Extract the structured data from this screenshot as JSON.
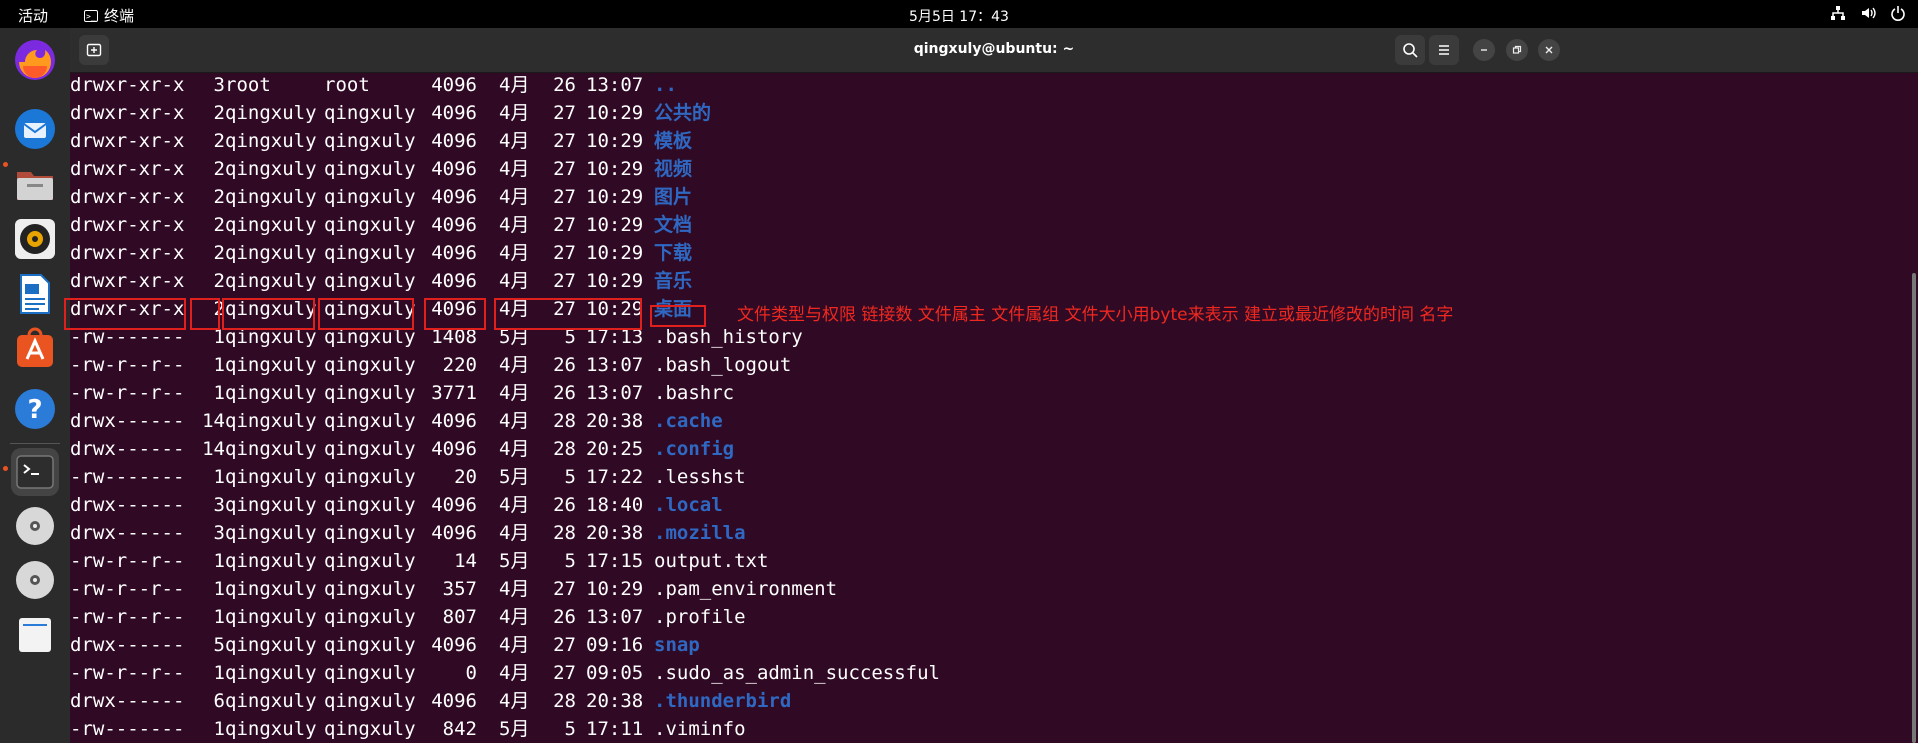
{
  "topbar": {
    "activities": "活动",
    "app_name": "终端",
    "clock": "5月5日  17：43"
  },
  "window": {
    "title": "qingxuly@ubuntu: ~"
  },
  "terminal": {
    "rows": [
      {
        "perm": "drwxr-xr-x",
        "links": "3",
        "owner": "root",
        "group": "root",
        "size": "4096",
        "month": "4月",
        "day": "26",
        "time": "13:07",
        "name": "..",
        "dir": true
      },
      {
        "perm": "drwxr-xr-x",
        "links": "2",
        "owner": "qingxuly",
        "group": "qingxuly",
        "size": "4096",
        "month": "4月",
        "day": "27",
        "time": "10:29",
        "name": "公共的",
        "dir": true
      },
      {
        "perm": "drwxr-xr-x",
        "links": "2",
        "owner": "qingxuly",
        "group": "qingxuly",
        "size": "4096",
        "month": "4月",
        "day": "27",
        "time": "10:29",
        "name": "模板",
        "dir": true
      },
      {
        "perm": "drwxr-xr-x",
        "links": "2",
        "owner": "qingxuly",
        "group": "qingxuly",
        "size": "4096",
        "month": "4月",
        "day": "27",
        "time": "10:29",
        "name": "视频",
        "dir": true
      },
      {
        "perm": "drwxr-xr-x",
        "links": "2",
        "owner": "qingxuly",
        "group": "qingxuly",
        "size": "4096",
        "month": "4月",
        "day": "27",
        "time": "10:29",
        "name": "图片",
        "dir": true
      },
      {
        "perm": "drwxr-xr-x",
        "links": "2",
        "owner": "qingxuly",
        "group": "qingxuly",
        "size": "4096",
        "month": "4月",
        "day": "27",
        "time": "10:29",
        "name": "文档",
        "dir": true
      },
      {
        "perm": "drwxr-xr-x",
        "links": "2",
        "owner": "qingxuly",
        "group": "qingxuly",
        "size": "4096",
        "month": "4月",
        "day": "27",
        "time": "10:29",
        "name": "下载",
        "dir": true
      },
      {
        "perm": "drwxr-xr-x",
        "links": "2",
        "owner": "qingxuly",
        "group": "qingxuly",
        "size": "4096",
        "month": "4月",
        "day": "27",
        "time": "10:29",
        "name": "音乐",
        "dir": true
      },
      {
        "perm": "drwxr-xr-x",
        "links": "2",
        "owner": "qingxuly",
        "group": "qingxuly",
        "size": "4096",
        "month": "4月",
        "day": "27",
        "time": "10:29",
        "name": "桌面",
        "dir": true
      },
      {
        "perm": "-rw-------",
        "links": "1",
        "owner": "qingxuly",
        "group": "qingxuly",
        "size": "1408",
        "month": "5月",
        "day": "5",
        "time": "17:13",
        "name": ".bash_history",
        "dir": false
      },
      {
        "perm": "-rw-r--r--",
        "links": "1",
        "owner": "qingxuly",
        "group": "qingxuly",
        "size": "220",
        "month": "4月",
        "day": "26",
        "time": "13:07",
        "name": ".bash_logout",
        "dir": false
      },
      {
        "perm": "-rw-r--r--",
        "links": "1",
        "owner": "qingxuly",
        "group": "qingxuly",
        "size": "3771",
        "month": "4月",
        "day": "26",
        "time": "13:07",
        "name": ".bashrc",
        "dir": false
      },
      {
        "perm": "drwx------",
        "links": "14",
        "owner": "qingxuly",
        "group": "qingxuly",
        "size": "4096",
        "month": "4月",
        "day": "28",
        "time": "20:38",
        "name": ".cache",
        "dir": true
      },
      {
        "perm": "drwx------",
        "links": "14",
        "owner": "qingxuly",
        "group": "qingxuly",
        "size": "4096",
        "month": "4月",
        "day": "28",
        "time": "20:25",
        "name": ".config",
        "dir": true
      },
      {
        "perm": "-rw-------",
        "links": "1",
        "owner": "qingxuly",
        "group": "qingxuly",
        "size": "20",
        "month": "5月",
        "day": "5",
        "time": "17:22",
        "name": ".lesshst",
        "dir": false
      },
      {
        "perm": "drwx------",
        "links": "3",
        "owner": "qingxuly",
        "group": "qingxuly",
        "size": "4096",
        "month": "4月",
        "day": "26",
        "time": "18:40",
        "name": ".local",
        "dir": true
      },
      {
        "perm": "drwx------",
        "links": "3",
        "owner": "qingxuly",
        "group": "qingxuly",
        "size": "4096",
        "month": "4月",
        "day": "28",
        "time": "20:38",
        "name": ".mozilla",
        "dir": true
      },
      {
        "perm": "-rw-r--r--",
        "links": "1",
        "owner": "qingxuly",
        "group": "qingxuly",
        "size": "14",
        "month": "5月",
        "day": "5",
        "time": "17:15",
        "name": "output.txt",
        "dir": false
      },
      {
        "perm": "-rw-r--r--",
        "links": "1",
        "owner": "qingxuly",
        "group": "qingxuly",
        "size": "357",
        "month": "4月",
        "day": "27",
        "time": "10:29",
        "name": ".pam_environment",
        "dir": false
      },
      {
        "perm": "-rw-r--r--",
        "links": "1",
        "owner": "qingxuly",
        "group": "qingxuly",
        "size": "807",
        "month": "4月",
        "day": "26",
        "time": "13:07",
        "name": ".profile",
        "dir": false
      },
      {
        "perm": "drwx------",
        "links": "5",
        "owner": "qingxuly",
        "group": "qingxuly",
        "size": "4096",
        "month": "4月",
        "day": "27",
        "time": "09:16",
        "name": "snap",
        "dir": true
      },
      {
        "perm": "-rw-r--r--",
        "links": "1",
        "owner": "qingxuly",
        "group": "qingxuly",
        "size": "0",
        "month": "4月",
        "day": "27",
        "time": "09:05",
        "name": ".sudo_as_admin_successful",
        "dir": false
      },
      {
        "perm": "drwx------",
        "links": "6",
        "owner": "qingxuly",
        "group": "qingxuly",
        "size": "4096",
        "month": "4月",
        "day": "28",
        "time": "20:38",
        "name": ".thunderbird",
        "dir": true
      },
      {
        "perm": "-rw-------",
        "links": "1",
        "owner": "qingxuly",
        "group": "qingxuly",
        "size": "842",
        "month": "5月",
        "day": "5",
        "time": "17:11",
        "name": ".viminfo",
        "dir": false
      }
    ]
  },
  "annotation": "文件类型与权限 链接数 文件属主 文件属组 文件大小用byte来表示 建立或最近修改的时间 名字",
  "colors": {
    "terminal_bg": "#300a24",
    "dir_blue": "#2f68c2",
    "annotation_red": "#f0281f"
  }
}
